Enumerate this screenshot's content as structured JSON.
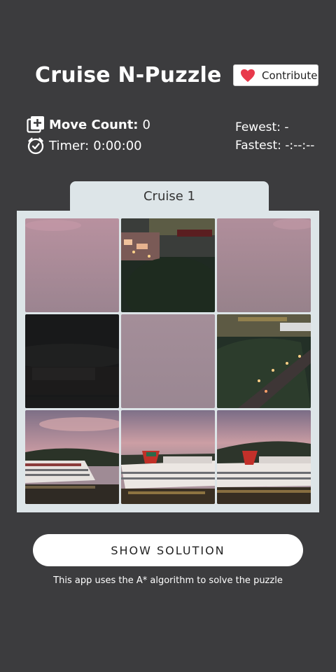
{
  "header": {
    "title": "Cruise N-Puzzle",
    "contribute_label": "Contribute",
    "accent_color": "#e8394b"
  },
  "stats": {
    "move_count_label": "Move Count:",
    "move_count_value": "0",
    "timer_label": "Timer:",
    "timer_value": "0:00:00",
    "fewest_label": "Fewest: -",
    "fastest_label": "Fastest: -:--:--"
  },
  "puzzle": {
    "tab_label": "Cruise 1",
    "grid_size": 3,
    "tiles": [
      {
        "content": "pink-sky"
      },
      {
        "content": "harbor-lights-top"
      },
      {
        "content": "pink-sky"
      },
      {
        "content": "dark-hillside"
      },
      {
        "content": "pink-sky"
      },
      {
        "content": "town-lights"
      },
      {
        "content": "ship-left"
      },
      {
        "content": "ship-center"
      },
      {
        "content": "ship-right"
      }
    ]
  },
  "actions": {
    "show_solution_label": "SHOW SOLUTION"
  },
  "footer": {
    "note": "This app uses the A* algorithm to solve the puzzle"
  }
}
